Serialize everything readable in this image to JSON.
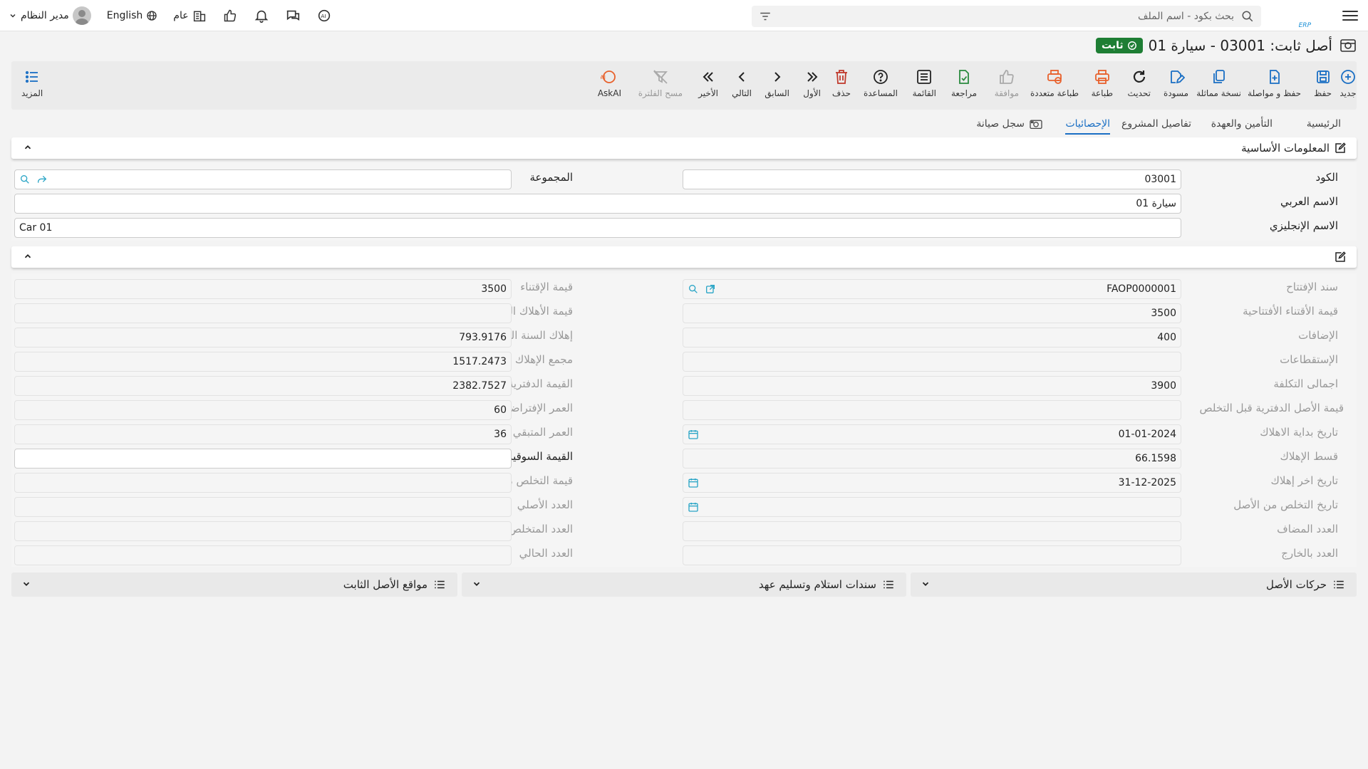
{
  "topbar": {
    "search_placeholder": "بحث بكود - اسم الملف",
    "user_name": "مدير النظام",
    "language_label": "English",
    "branch_label": "عام"
  },
  "page": {
    "title": "أصل ثابت: 03001 - سيارة 01",
    "status": "ثابت"
  },
  "toolbar": {
    "new": "جديد",
    "save": "حفظ",
    "save_continue": "حفظ و مواصلة",
    "duplicate": "نسخة مماثلة",
    "draft": "مسودة",
    "refresh": "تحديث",
    "print": "طباعة",
    "multi_print": "طباعة متعددة",
    "approve": "موافقة",
    "review": "مراجعة",
    "list": "القائمة",
    "help": "المساعدة",
    "delete": "حذف",
    "first": "الأول",
    "previous": "السابق",
    "next": "التالي",
    "last": "الأخير",
    "clear_filter": "مسح الفلترة",
    "ask_ai": "AskAI",
    "more": "المزيد"
  },
  "tabs": {
    "main": "الرئيسية",
    "insurance": "التأمين والعهدة",
    "project": "تفاصيل المشروع",
    "statistics": "الإحصائيات",
    "maintenance": "سجل صيانة"
  },
  "basic_info": {
    "title": "المعلومات الأساسية",
    "code_label": "الكود",
    "code_value": "03001",
    "group_label": "المجموعة",
    "group_value": "",
    "arabic_name_label": "الاسم العربي",
    "arabic_name_value": "سيارة 01",
    "english_name_label": "الاسم الإنجليزي",
    "english_name_value": "Car 01"
  },
  "stats": {
    "right": [
      {
        "label": "سند الإفتتاح",
        "value": "FAOP0000001"
      },
      {
        "label": "قيمة الأقتناء الأفتتاحية",
        "value": "3500"
      },
      {
        "label": "الإضافات",
        "value": "400"
      },
      {
        "label": "الإستقطاعات",
        "value": ""
      },
      {
        "label": "اجمالى التكلفة",
        "value": "3900"
      },
      {
        "label": "قيمة الأصل الدفترية قبل التخلص",
        "value": ""
      },
      {
        "label": "تاريخ بداية الاهلاك",
        "value": "01-01-2024"
      },
      {
        "label": "قسط الإهلاك",
        "value": "66.1598"
      },
      {
        "label": "تاريخ اخر إهلاك",
        "value": "31-12-2025"
      },
      {
        "label": "تاريخ التخلص من الأصل",
        "value": ""
      },
      {
        "label": "العدد المضاف",
        "value": ""
      },
      {
        "label": "العدد بالخارج",
        "value": ""
      }
    ],
    "left": [
      {
        "label": "قيمة الإقتناء",
        "value": "3500"
      },
      {
        "label": "قيمة الأهلاك التراكمي الأفتتاحية",
        "value": ""
      },
      {
        "label": "إهلاك السنة الحالية",
        "value": "793.9176"
      },
      {
        "label": "مجمع الإهلاك",
        "value": "1517.2473"
      },
      {
        "label": "القيمة الدفترية الحالية",
        "value": "2382.7527"
      },
      {
        "label": "العمر الإفتراضي",
        "value": "60"
      },
      {
        "label": "العمر المتبقي",
        "value": "36"
      },
      {
        "label": "القيمة السوقية",
        "value": ""
      },
      {
        "label": "قيمة التخلص من الأصل",
        "value": ""
      },
      {
        "label": "العدد الأصلي",
        "value": ""
      },
      {
        "label": "العدد المتخلص منه",
        "value": ""
      },
      {
        "label": "العدد الحالي",
        "value": ""
      }
    ]
  },
  "bottom_panels": {
    "movements": "حركات الأصل",
    "receipts": "سندات استلام وتسليم عهد",
    "locations": "مواقع الأصل الثابت"
  },
  "colors": {
    "accent": "#1a6fc4",
    "status_green": "#1e7e34",
    "print_orange": "#e8612c",
    "delete_red": "#c0392b"
  }
}
